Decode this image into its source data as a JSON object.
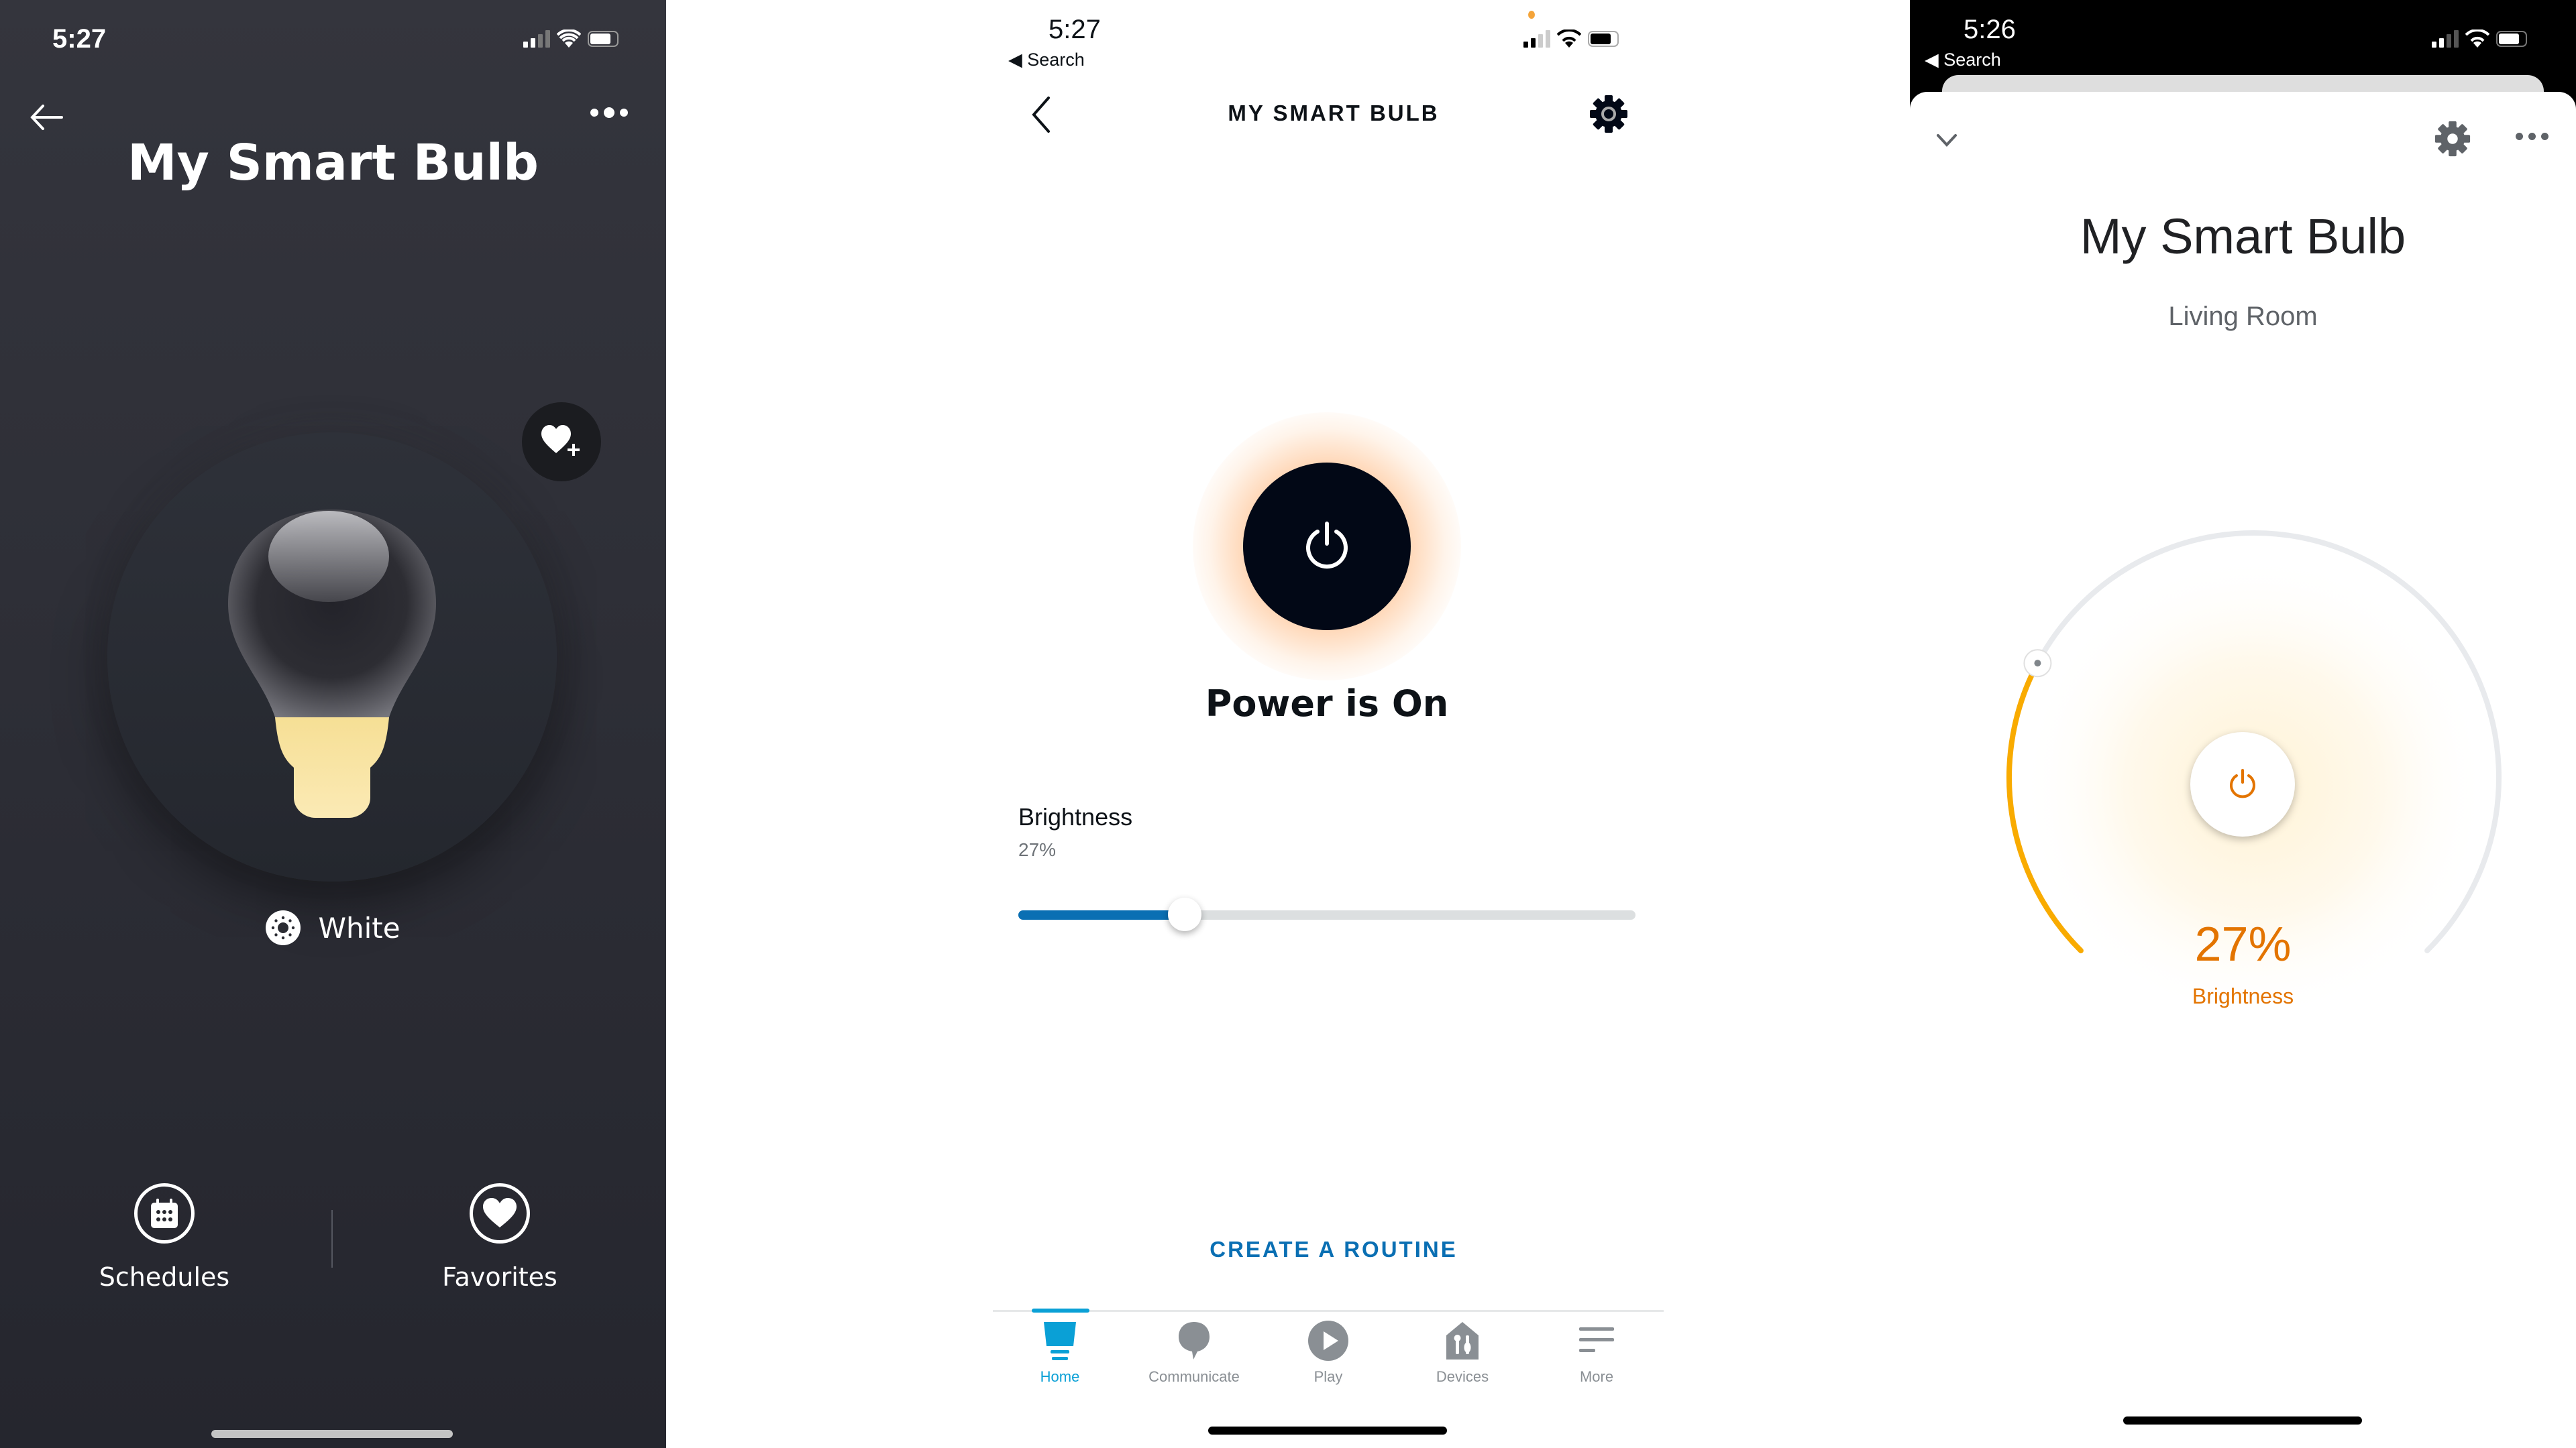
{
  "panels": {
    "smart_life": {
      "status_bar": {
        "time": "5:27"
      },
      "title": "My Smart Bulb",
      "icons": {
        "back": "arrow-left-icon",
        "more": "more-horizontal-icon",
        "favorite_add": "heart-plus-icon",
        "bulb": "light-bulb-icon",
        "mode": "sun-icon"
      },
      "mode_label": "White",
      "actions": [
        {
          "label": "Schedules",
          "icon": "calendar-icon"
        },
        {
          "label": "Favorites",
          "icon": "heart-icon"
        }
      ],
      "colors": {
        "background": "#2d2e36",
        "bulb_base": "#f7e3a0"
      }
    },
    "alexa": {
      "status_bar": {
        "time": "5:27",
        "back_app": "Search"
      },
      "header_title": "MY SMART BULB",
      "icons": {
        "back": "chevron-left-icon",
        "settings": "gear-icon",
        "power": "power-icon"
      },
      "power_status": "Power is On",
      "brightness": {
        "label": "Brightness",
        "value_text": "27%",
        "value": 27
      },
      "routine_link": "CREATE A ROUTINE",
      "nav": [
        {
          "label": "Home",
          "icon": "home-icon",
          "active": true
        },
        {
          "label": "Communicate",
          "icon": "chat-bubble-icon",
          "active": false
        },
        {
          "label": "Play",
          "icon": "play-icon",
          "active": false
        },
        {
          "label": "Devices",
          "icon": "devices-icon",
          "active": false
        },
        {
          "label": "More",
          "icon": "menu-icon",
          "active": false
        }
      ],
      "colors": {
        "accent": "#0a6fb3",
        "nav_active": "#0aa0d6",
        "glow": "#ffae6b"
      }
    },
    "google_home": {
      "status_bar": {
        "time": "5:26",
        "back_app": "Search"
      },
      "icons": {
        "collapse": "chevron-down-icon",
        "settings": "gear-icon",
        "more": "more-horizontal-icon",
        "power": "power-icon"
      },
      "title": "My Smart Bulb",
      "room": "Living Room",
      "brightness": {
        "value_text": "27%",
        "label": "Brightness",
        "value": 27
      },
      "colors": {
        "arc": "#f9ab00",
        "text_accent": "#e37400",
        "track": "#e8eaed"
      }
    }
  }
}
